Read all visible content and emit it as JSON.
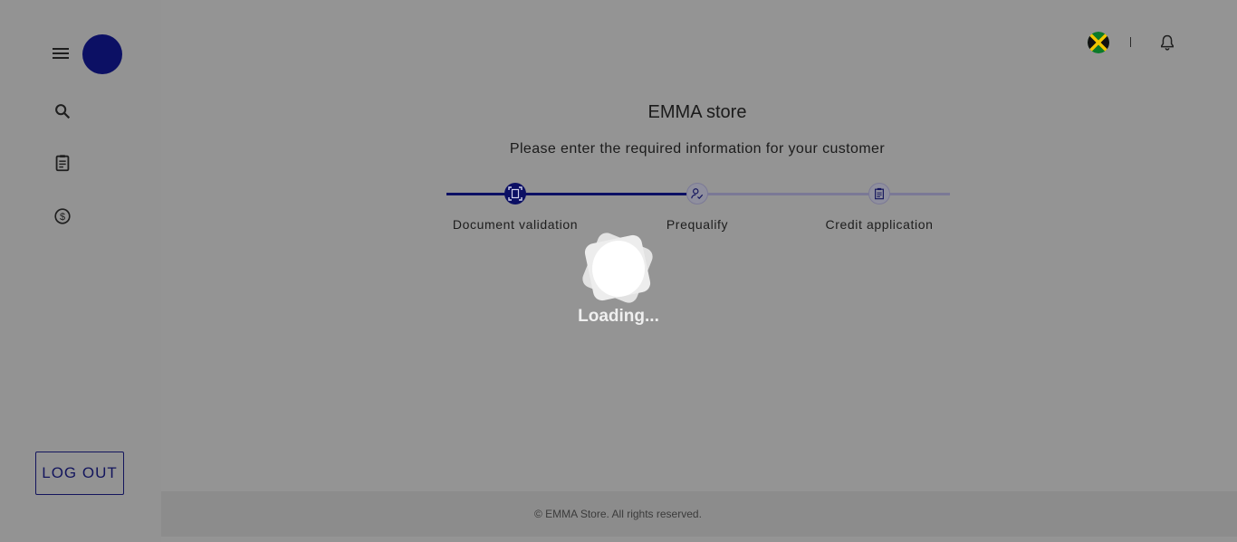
{
  "sidebar": {
    "menu_icon": "hamburger-icon",
    "avatar_color": "#0c1064",
    "nav_icons": [
      "search-icon",
      "clipboard-icon",
      "dollar-circle-icon"
    ],
    "logout_label": "LOG OUT"
  },
  "topbar": {
    "flag_icon": "jamaica-flag-icon",
    "divider_text": "|",
    "notifications_icon": "bell-icon"
  },
  "main": {
    "store_title": "EMMA store",
    "subtitle": "Please enter the required information for your customer",
    "steps": [
      {
        "label": "Document validation",
        "icon": "document-scan-icon",
        "state": "active"
      },
      {
        "label": "Prequalify",
        "icon": "person-check-icon",
        "state": "pending"
      },
      {
        "label": "Credit application",
        "icon": "clipboard-list-icon",
        "state": "pending"
      }
    ],
    "progress_fraction": 0.48
  },
  "loader": {
    "text": "Loading..."
  },
  "footer": {
    "text": "© EMMA Store. All rights reserved."
  },
  "colors": {
    "overlay_background": "#949494",
    "brand_navy": "#0c1064",
    "pending_track": "#7b7996"
  }
}
